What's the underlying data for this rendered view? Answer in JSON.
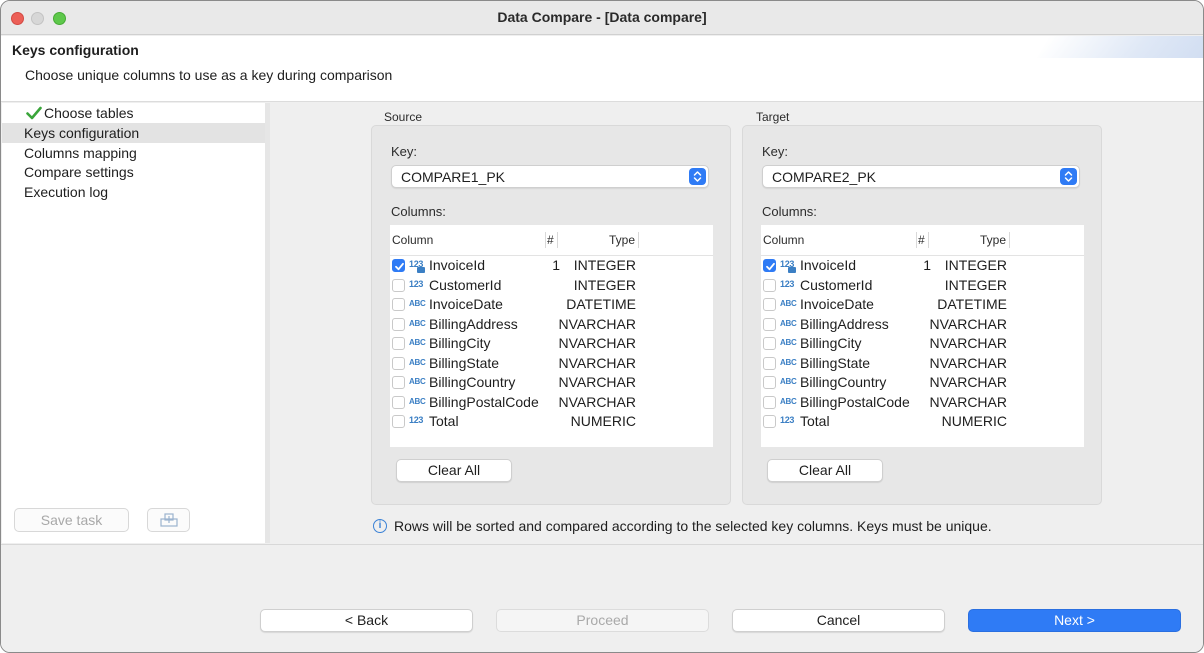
{
  "window": {
    "title": "Data Compare - [Data compare]"
  },
  "header": {
    "title": "Keys configuration",
    "description": "Choose unique columns to use as a key during comparison"
  },
  "sidebar": {
    "items": [
      {
        "label": "Choose tables",
        "done": true
      },
      {
        "label": "Keys configuration",
        "selected": true
      },
      {
        "label": "Columns mapping"
      },
      {
        "label": "Compare settings"
      },
      {
        "label": "Execution log"
      }
    ],
    "save_task_label": "Save task",
    "export_icon": "export-task-icon"
  },
  "source": {
    "group_label": "Source",
    "key_label": "Key:",
    "key_value": "COMPARE1_PK",
    "columns_label": "Columns:",
    "headers": {
      "column": "Column",
      "num": "#",
      "type": "Type"
    },
    "clear_label": "Clear All",
    "rows": [
      {
        "checked": true,
        "icon": "123",
        "name": "InvoiceId",
        "num": "1",
        "type": "INTEGER"
      },
      {
        "checked": false,
        "icon": "123",
        "name": "CustomerId",
        "num": "",
        "type": "INTEGER"
      },
      {
        "checked": false,
        "icon": "ABC",
        "name": "InvoiceDate",
        "num": "",
        "type": "DATETIME"
      },
      {
        "checked": false,
        "icon": "ABC",
        "name": "BillingAddress",
        "num": "",
        "type": "NVARCHAR"
      },
      {
        "checked": false,
        "icon": "ABC",
        "name": "BillingCity",
        "num": "",
        "type": "NVARCHAR"
      },
      {
        "checked": false,
        "icon": "ABC",
        "name": "BillingState",
        "num": "",
        "type": "NVARCHAR"
      },
      {
        "checked": false,
        "icon": "ABC",
        "name": "BillingCountry",
        "num": "",
        "type": "NVARCHAR"
      },
      {
        "checked": false,
        "icon": "ABC",
        "name": "BillingPostalCode",
        "num": "",
        "type": "NVARCHAR"
      },
      {
        "checked": false,
        "icon": "123",
        "name": "Total",
        "num": "",
        "type": "NUMERIC"
      }
    ]
  },
  "target": {
    "group_label": "Target",
    "key_label": "Key:",
    "key_value": "COMPARE2_PK",
    "columns_label": "Columns:",
    "headers": {
      "column": "Column",
      "num": "#",
      "type": "Type"
    },
    "clear_label": "Clear All",
    "rows": [
      {
        "checked": true,
        "icon": "123",
        "name": "InvoiceId",
        "num": "1",
        "type": "INTEGER"
      },
      {
        "checked": false,
        "icon": "123",
        "name": "CustomerId",
        "num": "",
        "type": "INTEGER"
      },
      {
        "checked": false,
        "icon": "ABC",
        "name": "InvoiceDate",
        "num": "",
        "type": "DATETIME"
      },
      {
        "checked": false,
        "icon": "ABC",
        "name": "BillingAddress",
        "num": "",
        "type": "NVARCHAR"
      },
      {
        "checked": false,
        "icon": "ABC",
        "name": "BillingCity",
        "num": "",
        "type": "NVARCHAR"
      },
      {
        "checked": false,
        "icon": "ABC",
        "name": "BillingState",
        "num": "",
        "type": "NVARCHAR"
      },
      {
        "checked": false,
        "icon": "ABC",
        "name": "BillingCountry",
        "num": "",
        "type": "NVARCHAR"
      },
      {
        "checked": false,
        "icon": "ABC",
        "name": "BillingPostalCode",
        "num": "",
        "type": "NVARCHAR"
      },
      {
        "checked": false,
        "icon": "123",
        "name": "Total",
        "num": "",
        "type": "NUMERIC"
      }
    ]
  },
  "info": {
    "icon": "info-icon",
    "text": "Rows will be sorted and compared according to the selected key columns. Keys must be unique."
  },
  "footer": {
    "back_label": "< Back",
    "proceed_label": "Proceed",
    "cancel_label": "Cancel",
    "next_label": "Next >"
  },
  "colors": {
    "accent": "#2f7bf5",
    "check": "#3aa53a",
    "type_icon": "#3b7fc4"
  }
}
